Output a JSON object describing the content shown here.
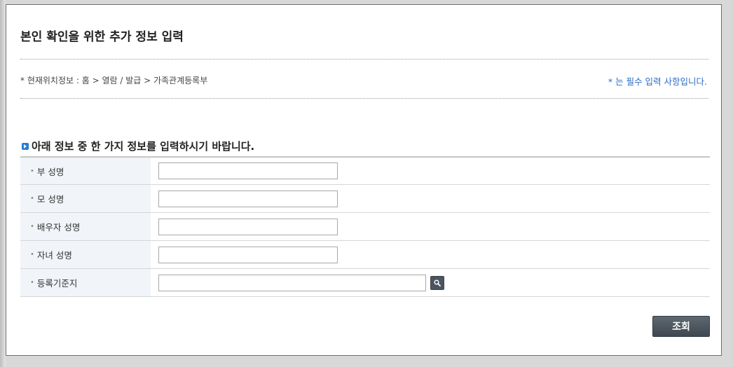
{
  "page": {
    "title": "본인 확인을 위한 추가 정보 입력",
    "breadcrumb": "* 현재위치정보 : 홈 > 열람 / 발급 > 가족관계등록부",
    "required_note": "* 는 필수 입력 사항입니다."
  },
  "section": {
    "heading": "아래 정보 중 한 가지 정보를 입력하시기 바랍니다."
  },
  "form": {
    "rows": [
      {
        "label": "부 성명",
        "value": ""
      },
      {
        "label": "모 성명",
        "value": ""
      },
      {
        "label": "배우자 성명",
        "value": ""
      },
      {
        "label": "자녀 성명",
        "value": ""
      },
      {
        "label": "등록기준지",
        "value": ""
      }
    ],
    "search_icon": "magnifier-icon",
    "submit_label": "조회"
  },
  "colors": {
    "accent_blue": "#2b6cc4",
    "label_bg": "#f1f4f8",
    "button_dark": "#4a5560"
  }
}
